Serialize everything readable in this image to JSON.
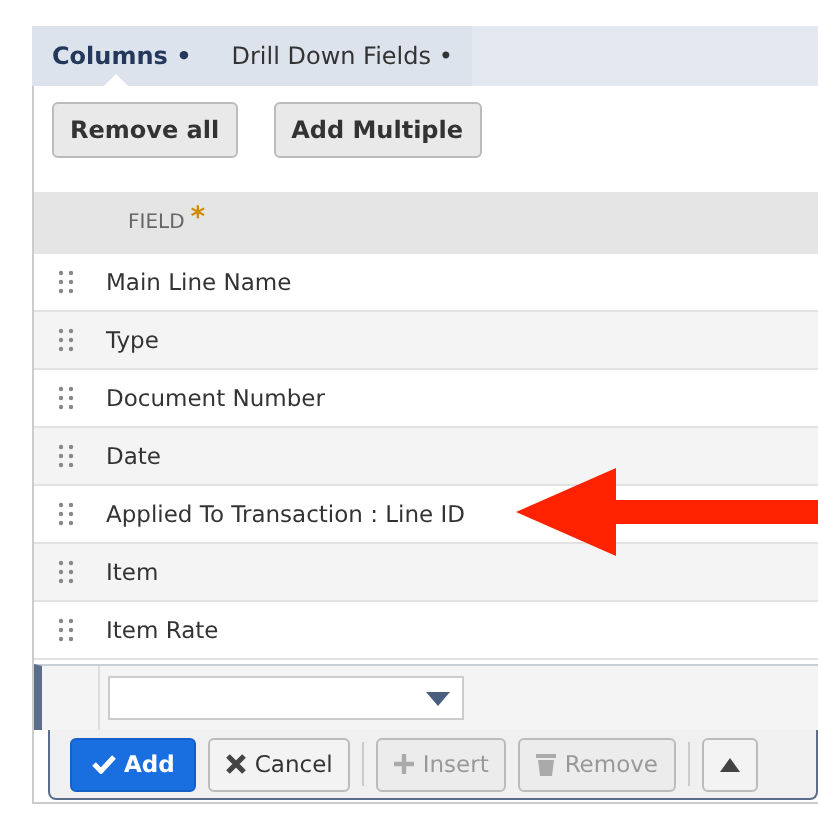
{
  "tabs": [
    {
      "label": "Columns •",
      "selected": true
    },
    {
      "label": "Drill Down Fields •",
      "selected": false
    }
  ],
  "actions": [
    "Remove all",
    "Add Multiple"
  ],
  "table": {
    "columns": [
      {
        "label": "FIELD",
        "required_mark": "*"
      }
    ],
    "rows": [
      "Main Line Name",
      "Type",
      "Document Number",
      "Date",
      "Applied To Transaction : Line ID",
      "Item",
      "Item Rate"
    ]
  },
  "editor": {
    "toolbar": [
      {
        "kind": "add",
        "label": "Add",
        "disabled": false
      },
      {
        "kind": "cancel",
        "label": "Cancel",
        "disabled": false
      },
      {
        "kind": "insert",
        "label": "Insert",
        "disabled": true
      },
      {
        "kind": "remove",
        "label": "Remove",
        "disabled": true
      },
      {
        "kind": "up",
        "disabled": false
      }
    ]
  }
}
